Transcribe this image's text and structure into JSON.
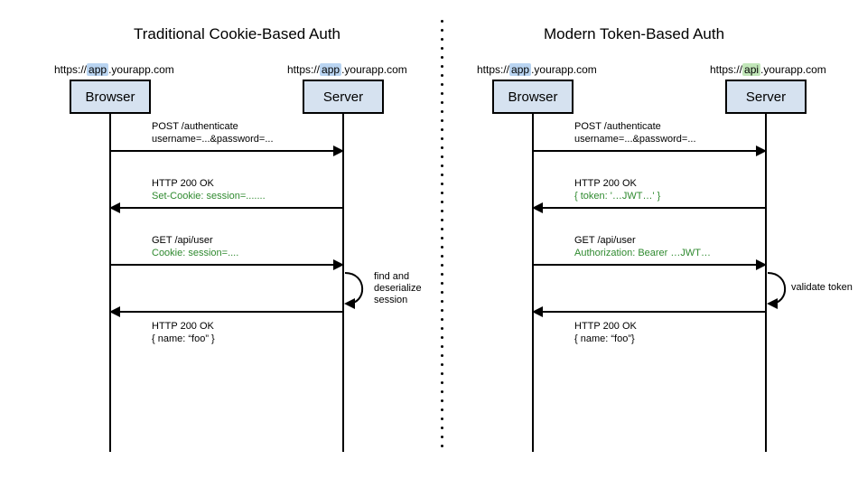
{
  "left": {
    "title": "Traditional Cookie-Based Auth",
    "browser_url_prefix": "https://",
    "browser_url_sub": "app",
    "browser_url_suffix": ".yourapp.com",
    "server_url_prefix": "https://",
    "server_url_sub": "app",
    "server_url_suffix": ".yourapp.com",
    "browser_label": "Browser",
    "server_label": "Server",
    "msg1_line1": "POST /authenticate",
    "msg1_line2": "username=...&password=...",
    "msg2_line1": "HTTP 200 OK",
    "msg2_line2": "Set-Cookie: session=.......",
    "msg3_line1": "GET /api/user",
    "msg3_line2": "Cookie: session=....",
    "self_note": "find and\ndeserialize\nsession",
    "msg4_line1": "HTTP 200 OK",
    "msg4_line2": "{  name: “foo” }"
  },
  "right": {
    "title": "Modern Token-Based Auth",
    "browser_url_prefix": "https://",
    "browser_url_sub": "app",
    "browser_url_suffix": ".yourapp.com",
    "server_url_prefix": "https://",
    "server_url_sub": "api",
    "server_url_suffix": ".yourapp.com",
    "browser_label": "Browser",
    "server_label": "Server",
    "msg1_line1": "POST /authenticate",
    "msg1_line2": "username=...&password=...",
    "msg2_line1": "HTTP 200 OK",
    "msg2_line2": "{ token: '…JWT…' }",
    "msg3_line1": "GET /api/user",
    "msg3_line2": "Authorization: Bearer …JWT…",
    "self_note": "validate token",
    "msg4_line1": "HTTP 200 OK",
    "msg4_line2": "{ name: “foo”}"
  }
}
